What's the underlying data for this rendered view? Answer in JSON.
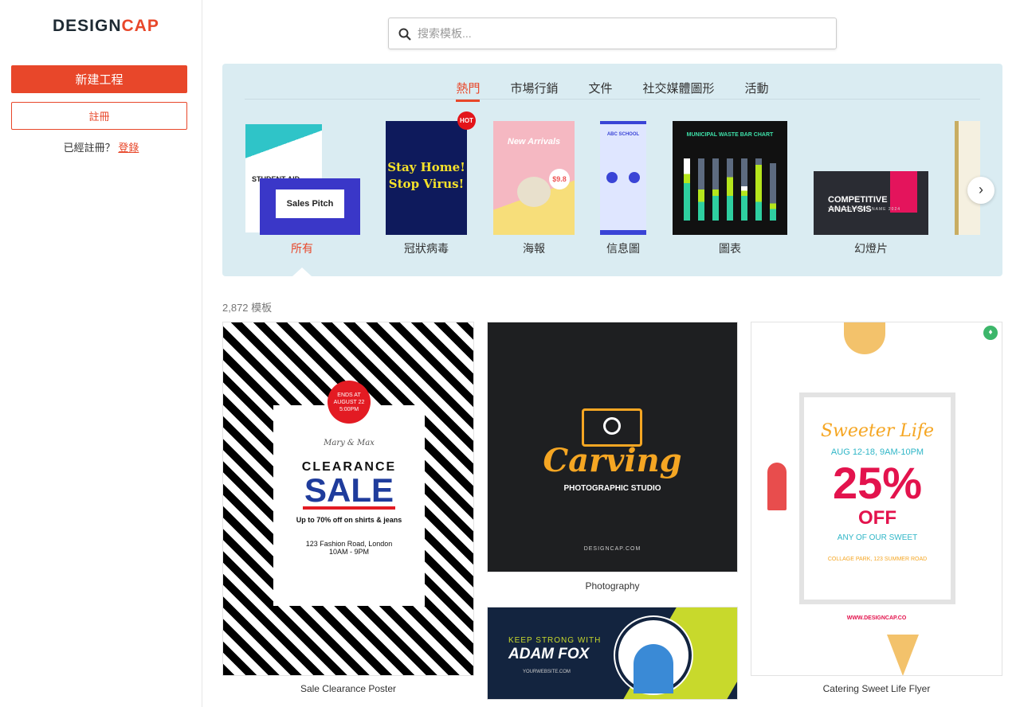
{
  "sidebar": {
    "logo_a": "DESIGN",
    "logo_b": "CAP",
    "new_project": "新建工程",
    "register": "註冊",
    "already": "已經註冊？",
    "login": "登錄"
  },
  "search": {
    "placeholder": "搜索模板..."
  },
  "tabs": [
    {
      "label": "熱門",
      "active": true
    },
    {
      "label": "市場行銷"
    },
    {
      "label": "文件"
    },
    {
      "label": "社交媒體圖形"
    },
    {
      "label": "活動"
    }
  ],
  "categories": [
    {
      "label": "所有",
      "active": true,
      "thumb_text_1": "STUDENT AID",
      "thumb_text_2": "Sales Pitch"
    },
    {
      "label": "冠狀病毒",
      "badge": "HOT",
      "thumb_text_1": "Stay Home!",
      "thumb_text_2": "Stop Virus!"
    },
    {
      "label": "海報",
      "thumb_text_1": "New Arrivals",
      "thumb_text_2": "$9.8"
    },
    {
      "label": "信息圖",
      "thumb_text_1": "ABC SCHOOL"
    },
    {
      "label": "圖表",
      "thumb_text_1": "MUNICIPAL WASTE BAR CHART"
    },
    {
      "label": "幻燈片",
      "thumb_text_1": "COMPETITIVE ANALYSIS",
      "thumb_text_2": "YOUR COMPANY NAME 2024"
    }
  ],
  "count": "2,872 模板",
  "templates": [
    {
      "title": "Sale Clearance Poster",
      "badge": "ENDS AT AUGUST 22 5:00PM",
      "names": "Mary & Max",
      "line1": "CLEARANCE",
      "line2": "SALE",
      "line3": "Up to 70% off on shirts & jeans",
      "line4": "123 Fashion Road, London",
      "line5": "10AM - 9PM"
    },
    {
      "title": "Photography",
      "line1": "Carving",
      "line2": "PHOTOGRAPHIC STUDIO",
      "line3": "DESIGNCAP.COM"
    },
    {
      "title": "",
      "line1": "KEEP STRONG WITH",
      "line2": "ADAM FOX",
      "line3": "YOURWEBSITE.COM"
    },
    {
      "title": "Catering Sweet Life Flyer",
      "line1": "Sweeter Life",
      "line2": "AUG 12-18, 9AM-10PM",
      "line3": "25%",
      "line4": "OFF",
      "line5": "ANY OF OUR SWEET",
      "line6": "COLLAGE PARK, 123 SUMMER ROAD",
      "line7": "WWW.DESIGNCAP.CO"
    }
  ],
  "colors": {
    "accent": "#e8472a",
    "panel": "#daecf2"
  }
}
